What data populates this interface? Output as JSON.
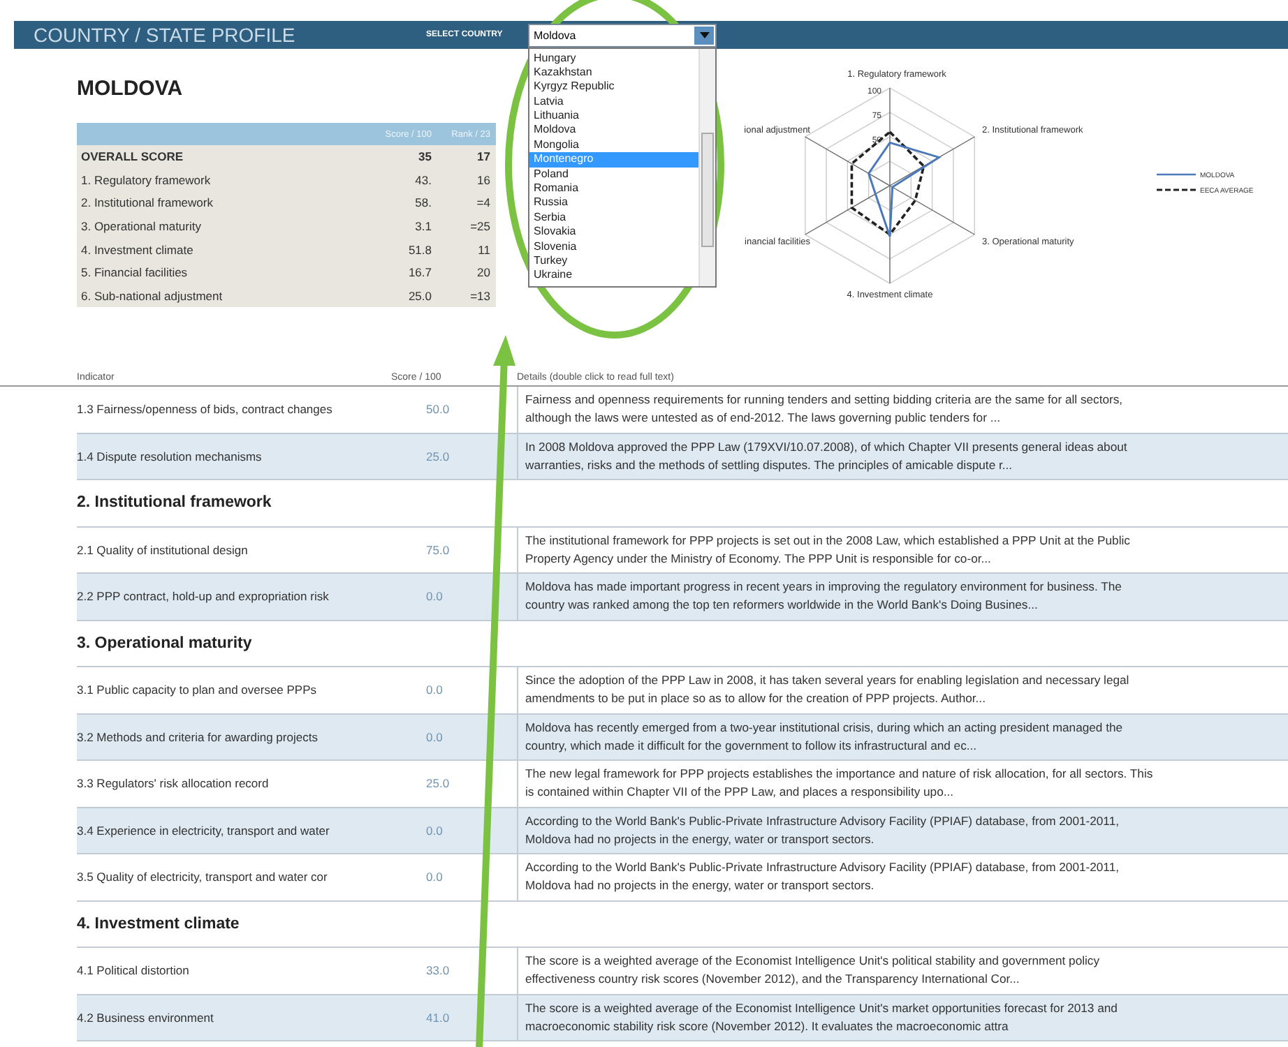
{
  "header": {
    "title": "COUNTRY / STATE PROFILE",
    "select_label": "SELECT COUNTRY",
    "selected_country": "Moldova"
  },
  "dropdown": {
    "options": [
      {
        "label": "Hungary",
        "selected": false
      },
      {
        "label": "Kazakhstan",
        "selected": false
      },
      {
        "label": "Kyrgyz Republic",
        "selected": false
      },
      {
        "label": "Latvia",
        "selected": false
      },
      {
        "label": "Lithuania",
        "selected": false
      },
      {
        "label": "Moldova",
        "selected": false
      },
      {
        "label": "Mongolia",
        "selected": false
      },
      {
        "label": "Montenegro",
        "selected": true
      },
      {
        "label": "Poland",
        "selected": false
      },
      {
        "label": "Romania",
        "selected": false
      },
      {
        "label": "Russia",
        "selected": false
      },
      {
        "label": "Serbia",
        "selected": false
      },
      {
        "label": "Slovakia",
        "selected": false
      },
      {
        "label": "Slovenia",
        "selected": false
      },
      {
        "label": "Turkey",
        "selected": false
      },
      {
        "label": "Ukraine",
        "selected": false
      }
    ]
  },
  "country_title": "MOLDOVA",
  "summary": {
    "columns": [
      "Score / 100",
      "Rank / 23"
    ],
    "rows": [
      {
        "label": "OVERALL SCORE",
        "score": "35",
        "rank": "17",
        "kind": "total"
      },
      {
        "label": "1. Regulatory framework",
        "score": "43.",
        "rank": "16",
        "kind": "item"
      },
      {
        "label": "2. Institutional framework",
        "score": "58.",
        "rank": "=4",
        "kind": "item"
      },
      {
        "label": "3. Operational maturity",
        "score": "3.1",
        "rank": "=25",
        "kind": "item"
      },
      {
        "label": "4. Investment climate",
        "score": "51.8",
        "rank": "11",
        "kind": "item"
      },
      {
        "label": "5. Financial facilities",
        "score": "16.7",
        "rank": "20",
        "kind": "item"
      },
      {
        "label": "6. Sub-national adjustment",
        "score": "25.0",
        "rank": "=13",
        "kind": "item"
      }
    ]
  },
  "radar": {
    "axis_labels": [
      "1. Regulatory framework",
      "ional adjustment",
      "2. Institutional framework",
      "inancial facilities",
      "3. Operational maturity",
      "4. Investment climate"
    ],
    "ticks": [
      "100",
      "75",
      "50"
    ],
    "legend": [
      {
        "label": "MOLDOVA",
        "kind": "solid"
      },
      {
        "label": "EECA AVERAGE",
        "kind": "dashed"
      }
    ]
  },
  "details": {
    "columns": [
      "Indicator",
      "Score / 100",
      "Details (double click to read full text)"
    ],
    "items": [
      {
        "kind": "row",
        "indicator": "1.3 Fairness/openness of bids, contract changes",
        "score": "50.0",
        "text": [
          "Fairness and openness requirements for running tenders and setting bidding criteria are the same for all sectors,",
          "although the laws were untested as of end-2012. The laws governing public tenders for ..."
        ]
      },
      {
        "kind": "row",
        "indicator": "1.4 Dispute resolution mechanisms",
        "score": "25.0",
        "text": [
          "In 2008 Moldova approved the PPP Law (179XVI/10.07.2008), of which Chapter VII presents general ideas about",
          "warranties, risks and the methods of settling disputes. The principles of amicable dispute r..."
        ]
      },
      {
        "kind": "heading",
        "indicator": "2. Institutional framework"
      },
      {
        "kind": "row",
        "indicator": "2.1 Quality of institutional design",
        "score": "75.0",
        "text": [
          "The institutional framework for PPP projects is set out in the 2008 Law, which established a PPP Unit at the Public",
          "Property Agency under the Ministry of Economy. The PPP Unit is responsible for co-or..."
        ]
      },
      {
        "kind": "row",
        "indicator": "2.2 PPP contract, hold-up and expropriation risk",
        "score": "0.0",
        "text": [
          "Moldova has made important progress in recent years in improving the regulatory environment for business. The",
          "country was ranked among the top ten reformers worldwide in the World Bank's Doing Busines..."
        ]
      },
      {
        "kind": "heading",
        "indicator": "3. Operational maturity"
      },
      {
        "kind": "row",
        "indicator": "3.1 Public capacity to plan and oversee PPPs",
        "score": "0.0",
        "text": [
          "Since the adoption of the PPP Law in 2008, it has taken several years for enabling legislation and necessary legal",
          "amendments to be put in place so as to allow for the creation of PPP projects. Author..."
        ]
      },
      {
        "kind": "row",
        "indicator": "3.2 Methods and criteria for awarding projects",
        "score": "0.0",
        "text": [
          "Moldova has recently emerged from a two-year institutional crisis, during which an acting president managed the",
          "country, which made it difficult for the government to follow its infrastructural and ec..."
        ]
      },
      {
        "kind": "row",
        "indicator": "3.3 Regulators' risk allocation record",
        "score": "25.0",
        "text": [
          "The new legal framework for PPP projects establishes the importance and nature of risk allocation, for all sectors. This",
          "is contained within Chapter VII of the PPP Law, and places a responsibility upo..."
        ]
      },
      {
        "kind": "row",
        "indicator": "3.4 Experience in electricity, transport and water",
        "score": "0.0",
        "text": [
          "According to the World Bank's Public-Private Infrastructure Advisory Facility (PPIAF) database, from 2001-2011,",
          "Moldova had no projects in the energy, water or transport sectors."
        ]
      },
      {
        "kind": "row",
        "indicator": "3.5 Quality of electricity, transport and water cor",
        "score": "0.0",
        "text": [
          "According to the World Bank's Public-Private Infrastructure Advisory Facility (PPIAF) database, from 2001-2011,",
          "Moldova had no projects in the energy, water or transport sectors."
        ]
      },
      {
        "kind": "heading",
        "indicator": "4. Investment climate"
      },
      {
        "kind": "row",
        "indicator": "4.1 Political distortion",
        "score": "33.0",
        "text": [
          "The score is a weighted average of the Economist Intelligence Unit's political stability and government policy",
          "effectiveness country risk scores (November 2012), and the Transparency International Cor..."
        ]
      },
      {
        "kind": "row",
        "indicator": "4.2 Business environment",
        "score": "41.0",
        "text": [
          "The score is a weighted average of the Economist Intelligence Unit's market opportunities forecast for 2013 and",
          "macroeconomic stability risk score (November 2012). It evaluates the macroeconomic attra"
        ]
      }
    ]
  }
}
